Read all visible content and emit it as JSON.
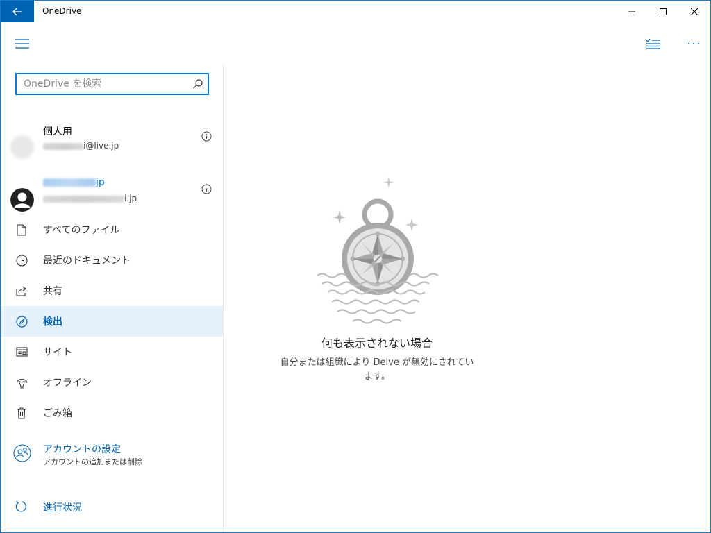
{
  "window": {
    "title": "OneDrive"
  },
  "search": {
    "placeholder": "OneDrive を検索"
  },
  "accounts": [
    {
      "name": "個人用",
      "email_suffix": "i@live.jp"
    },
    {
      "name_suffix": "jp",
      "email_suffix": "i.jp"
    }
  ],
  "nav": {
    "items": [
      {
        "label": "すべてのファイル",
        "icon": "file-icon"
      },
      {
        "label": "最近のドキュメント",
        "icon": "clock-icon"
      },
      {
        "label": "共有",
        "icon": "share-icon"
      },
      {
        "label": "検出",
        "icon": "compass-icon",
        "active": true
      },
      {
        "label": "サイト",
        "icon": "sites-icon"
      },
      {
        "label": "オフライン",
        "icon": "offline-icon"
      },
      {
        "label": "ごみ箱",
        "icon": "trash-icon"
      }
    ]
  },
  "settings": {
    "label": "アカウントの設定",
    "sub": "アカウントの追加または削除"
  },
  "progress": {
    "label": "進行状況"
  },
  "empty_state": {
    "title": "何も表示されない場合",
    "description": "自分または組織により Delve が無効にされています。"
  },
  "colors": {
    "accent": "#0063b1",
    "active_bg": "#e5f1fb",
    "border": "#1979ca"
  }
}
